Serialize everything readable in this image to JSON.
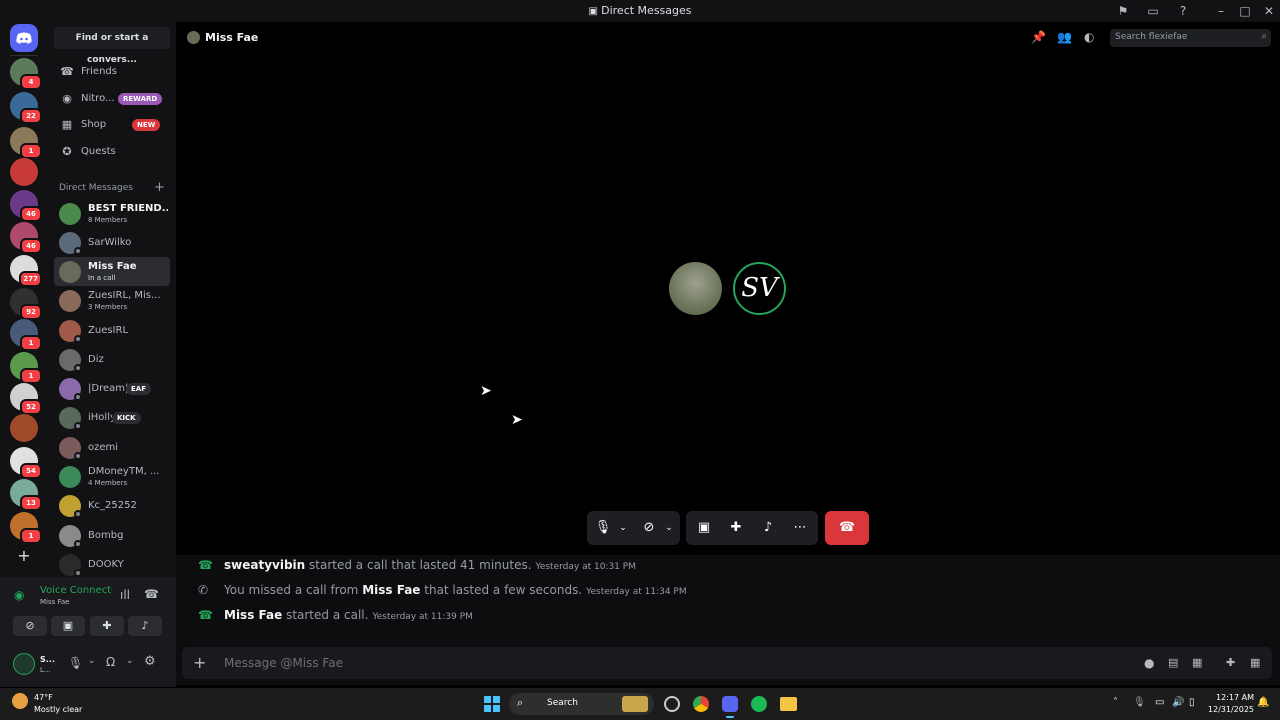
{
  "window": {
    "title": "Direct Messages"
  },
  "servers": [
    {
      "badge": "4",
      "color": "#5a7a5a"
    },
    {
      "badge": "22",
      "color": "#3a6a9a"
    },
    {
      "badge": "1",
      "color": "#8a7a5a"
    },
    {
      "badge": "",
      "color": "#c83a3a"
    },
    {
      "badge": "46",
      "color": "#6a3a8a"
    },
    {
      "badge": "46",
      "color": "#b04a6a"
    },
    {
      "badge": "277",
      "color": "#dcdcdc"
    },
    {
      "badge": "92",
      "color": "#303030"
    },
    {
      "badge": "1",
      "color": "#4a5a7a"
    },
    {
      "badge": "1",
      "color": "#5a9a4a"
    },
    {
      "badge": "52",
      "color": "#d0d0d0"
    },
    {
      "badge": "",
      "color": "#a04a2a"
    },
    {
      "badge": "54",
      "color": "#e0e0e0"
    },
    {
      "badge": "13",
      "color": "#7aaa9a"
    },
    {
      "badge": "1",
      "color": "#c0702a"
    }
  ],
  "sidebar": {
    "search_label": "Find or start a convers...",
    "nav": [
      {
        "label": "Friends",
        "icon": "friends-icon",
        "tag": ""
      },
      {
        "label": "Nitro...",
        "icon": "nitro-icon",
        "tag": "REWARD"
      },
      {
        "label": "Shop",
        "icon": "shop-icon",
        "tag": "NEW"
      },
      {
        "label": "Quests",
        "icon": "quests-icon",
        "tag": ""
      }
    ],
    "dm_header": "Direct Messages",
    "dms": [
      {
        "name": "BEST FRIEND...",
        "sub": "8 Members",
        "color": "#4a8a4a"
      },
      {
        "name": "SarWilko",
        "sub": "",
        "color": "#5a6a7a"
      },
      {
        "name": "Miss Fae",
        "sub": "In a call",
        "color": "#6a6a5a"
      },
      {
        "name": "ZuesIRL, Mis...",
        "sub": "3 Members",
        "color": "#8a6a5a"
      },
      {
        "name": "ZuesIRL",
        "sub": "",
        "color": "#a05a4a"
      },
      {
        "name": "Diz",
        "sub": "",
        "color": "#6a6a6a"
      },
      {
        "name": "|Dream|",
        "sub": "",
        "tag": "EAF",
        "color": "#8a6aaa"
      },
      {
        "name": "iHolly",
        "sub": "",
        "tag": "KICK",
        "color": "#5a6a5a"
      },
      {
        "name": "ozemi",
        "sub": "",
        "color": "#7a5a5a"
      },
      {
        "name": "DMoneyTM, ...",
        "sub": "4 Members",
        "color": "#3a8a5a"
      },
      {
        "name": "Kc_25252",
        "sub": "",
        "color": "#c0a030"
      },
      {
        "name": "Bombg",
        "sub": "",
        "color": "#8a8a8a"
      },
      {
        "name": "DOOKY",
        "sub": "",
        "color": "#2a2a2a"
      }
    ]
  },
  "voice": {
    "status": "Voice Connected",
    "channel": "Miss Fae"
  },
  "user": {
    "name": "S...",
    "status": "L..."
  },
  "header": {
    "name": "Miss Fae",
    "search_placeholder": "Search flexiefae"
  },
  "call": {
    "avatar2_text": "SV"
  },
  "messages": [
    {
      "pre": "",
      "who": "sweatyvibin",
      "post": " started a call that lasted 41 minutes.",
      "ts": "Yesterday at 10:31 PM",
      "who_first": true,
      "missed": false
    },
    {
      "pre": "You missed a call from ",
      "who": "Miss Fae",
      "post": " that lasted a few seconds.",
      "ts": "Yesterday at 11:34 PM",
      "who_first": false,
      "missed": true
    },
    {
      "pre": "",
      "who": "Miss Fae",
      "post": " started a call.",
      "ts": "Yesterday at 11:39 PM",
      "who_first": true,
      "missed": false
    }
  ],
  "composer": {
    "placeholder": "Message @Miss Fae"
  },
  "taskbar": {
    "weather_temp": "47°F",
    "weather_desc": "Mostly clear",
    "search_label": "Search",
    "time": "12:17 AM",
    "date": "12/31/2025"
  }
}
